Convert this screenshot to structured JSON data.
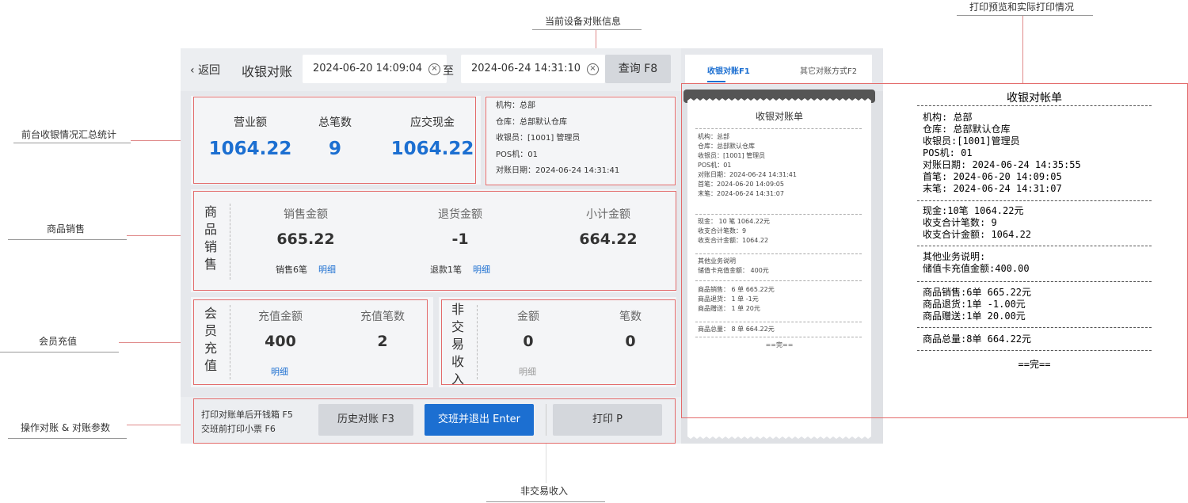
{
  "callouts": {
    "device_info": "当前设备对账信息",
    "print_preview": "打印预览和实际打印情况",
    "summary": "前台收银情况汇总统计",
    "goods_sales": "商品销售",
    "member_recharge": "会员充值",
    "operate": "操作对账 & 对账参数",
    "non_trade": "非交易收入"
  },
  "topbar": {
    "back": "返回",
    "title": "收银对账",
    "start_date": "2024-06-20 14:09:04",
    "to": "至",
    "end_date": "2024-06-24 14:31:10",
    "query": "查询 F8"
  },
  "summary": {
    "revenue_label": "营业额",
    "revenue": "1064.22",
    "count_label": "总笔数",
    "count": "9",
    "cash_label": "应交现金",
    "cash": "1064.22"
  },
  "device": {
    "org": "机构：总部",
    "warehouse": "仓库：总部默认仓库",
    "cashier": "收银员：[1001] 管理员",
    "pos": "POS机：01",
    "date": "对账日期：2024-06-24 14:31:41"
  },
  "goods": {
    "side": [
      "商",
      "品",
      "销",
      "售"
    ],
    "sales_label": "销售金额",
    "sales": "665.22",
    "sales_note": "销售6笔",
    "sales_link": "明细",
    "refund_label": "退货金额",
    "refund": "-1",
    "refund_note": "退款1笔",
    "refund_link": "明细",
    "subtotal_label": "小计金额",
    "subtotal": "664.22"
  },
  "member": {
    "side": [
      "会",
      "员",
      "充",
      "值"
    ],
    "amount_label": "充值金额",
    "amount": "400",
    "link": "明细",
    "count_label": "充值笔数",
    "count": "2"
  },
  "nontrade": {
    "side": [
      "非",
      "交",
      "易",
      "收",
      "入"
    ],
    "amount_label": "金额",
    "amount": "0",
    "link": "明细",
    "count_label": "笔数",
    "count": "0"
  },
  "bottom": {
    "opt1": "打印对账单后开钱箱 F5",
    "opt2": "交班前打印小票 F6",
    "history": "历史对账 F3",
    "handover": "交班并退出 Enter",
    "print": "打印 P"
  },
  "tabs": {
    "tab1": "收银对账F1",
    "tab2": "其它对账方式F2"
  },
  "receipt": {
    "title": "收银对账单",
    "lines1": [
      "机构：总部",
      "仓库：总部默认仓库",
      "收银员：[1001] 管理员",
      "POS机：01",
      "对账日期：2024-06-24 14:31:41",
      "首笔：2024-06-20 14:09:05",
      "末笔：2024-06-24 14:31:07"
    ],
    "lines2": [
      "现金： 10 笔  1064.22元",
      "收支合计笔数：9",
      "收支合计金额：1064.22"
    ],
    "lines3": [
      "其他业务说明",
      "储值卡充值金额： 400元"
    ],
    "lines4": [
      "商品销售： 6 单  665.22元",
      "商品退货： 1 单  -1元",
      "商品赠送： 1 单  20元"
    ],
    "lines5": [
      "商品总量： 8 单  664.22元"
    ],
    "end": "==完=="
  },
  "print": {
    "title": "收银对帐单",
    "lines1": [
      "机构:  总部",
      " 仓库:  总部默认仓库",
      " 收银员:[1001]管理员",
      " POS机:  01",
      " 对账日期: 2024-06-24  14:35:55",
      " 首笔:  2024-06-20  14:09:05",
      " 末笔:  2024-06-24  14:31:07"
    ],
    "lines2": [
      "现金:10笔  1064.22元",
      " 收支合计笔数: 9",
      " 收支合计金额: 1064.22"
    ],
    "lines3": [
      "其他业务说明:",
      " 储值卡充值金额:400.00"
    ],
    "lines4": [
      "商品销售:6单  665.22元",
      "商品退货:1单  -1.00元",
      "商品赠送:1单  20.00元"
    ],
    "lines5": [
      "商品总量:8单  664.22元"
    ],
    "end": "==完=="
  }
}
